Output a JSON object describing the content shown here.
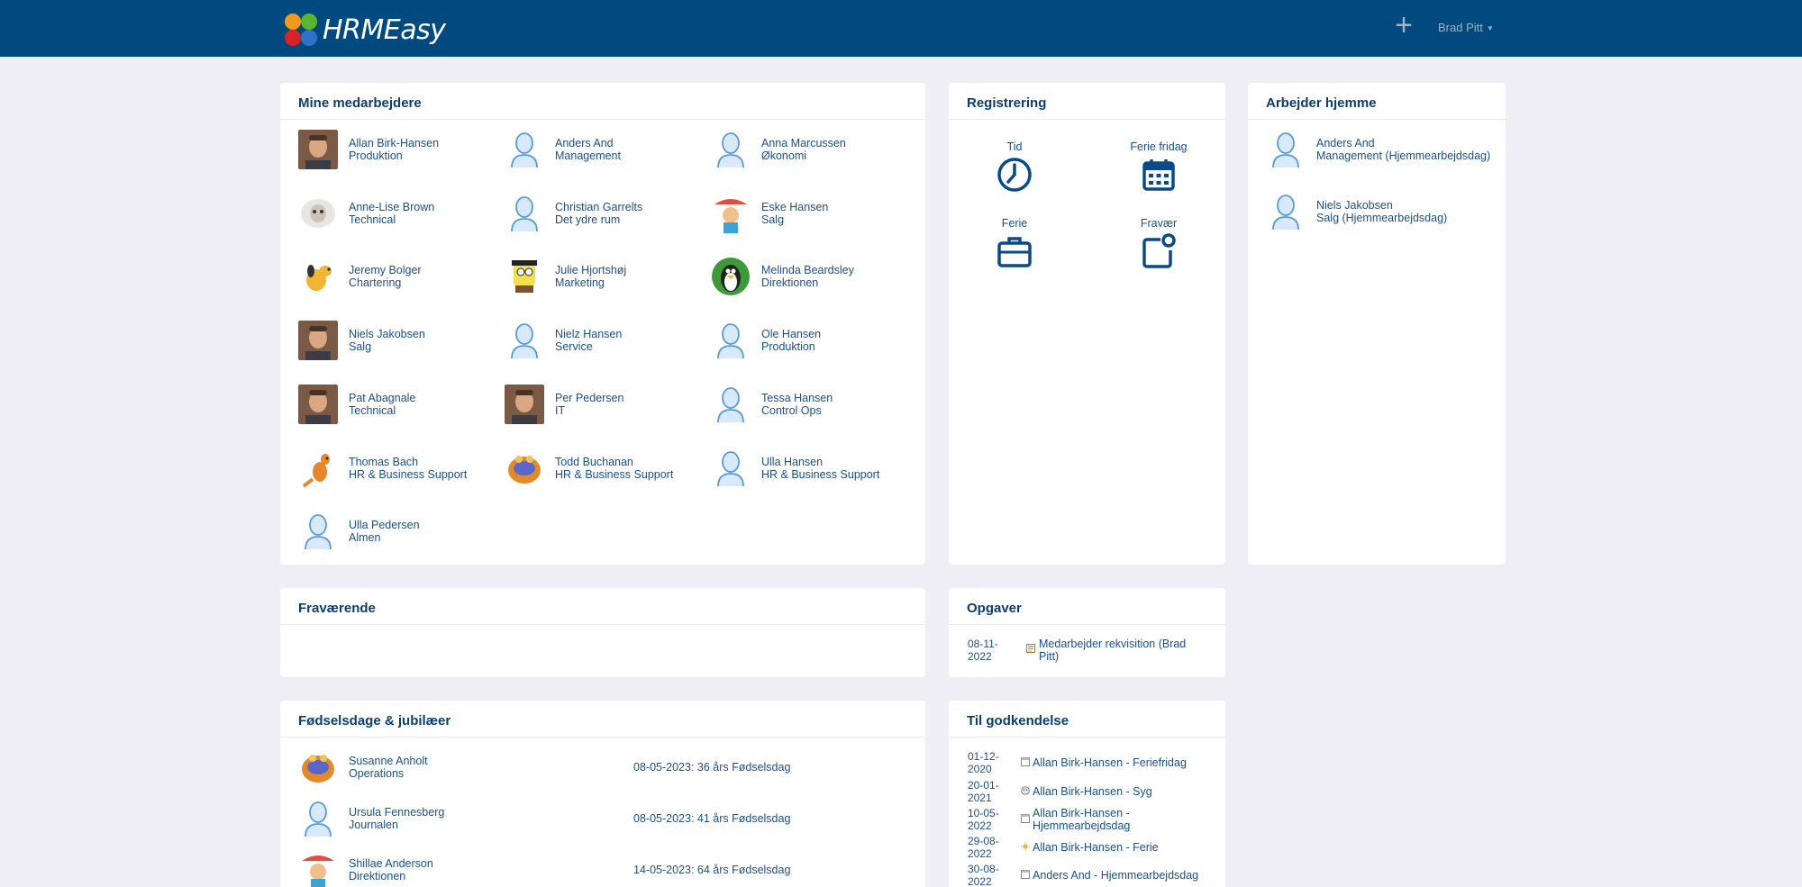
{
  "app": {
    "name": "HRMEasy"
  },
  "header": {
    "user_name": "Brad Pitt",
    "add_icon": "plus-icon"
  },
  "colors": {
    "topbar": "#004a80",
    "background": "#eeeef4",
    "text": "#1b4f88",
    "icon": "#0b4a86"
  },
  "employees_panel": {
    "title": "Mine medarbejdere",
    "items": [
      {
        "name": "Allan Birk-Hansen",
        "dept": "Produktion",
        "avatar": "photo"
      },
      {
        "name": "Anders And",
        "dept": "Management",
        "avatar": "default"
      },
      {
        "name": "Anna Marcussen",
        "dept": "Økonomi",
        "avatar": "default"
      },
      {
        "name": "Anne-Lise Brown",
        "dept": "Technical",
        "avatar": "sheep"
      },
      {
        "name": "Christian Garrelts",
        "dept": "Det ydre rum",
        "avatar": "default"
      },
      {
        "name": "Eske Hansen",
        "dept": "Salg",
        "avatar": "cartoon"
      },
      {
        "name": "Jeremy Bolger",
        "dept": "Chartering",
        "avatar": "dog"
      },
      {
        "name": "Julie Hjortshøj",
        "dept": "Marketing",
        "avatar": "sponge"
      },
      {
        "name": "Melinda Beardsley",
        "dept": "Direktionen",
        "avatar": "penguin"
      },
      {
        "name": "Niels Jakobsen",
        "dept": "Salg",
        "avatar": "photo"
      },
      {
        "name": "Nielz Hansen",
        "dept": "Service",
        "avatar": "default"
      },
      {
        "name": "Ole Hansen",
        "dept": "Produktion",
        "avatar": "default"
      },
      {
        "name": "Pat Abagnale",
        "dept": "Technical",
        "avatar": "photo"
      },
      {
        "name": "Per Pedersen",
        "dept": "IT",
        "avatar": "photo"
      },
      {
        "name": "Tessa Hansen",
        "dept": "Control Ops",
        "avatar": "default"
      },
      {
        "name": "Thomas Bach",
        "dept": "HR & Business Support",
        "avatar": "kangaroo"
      },
      {
        "name": "Todd Buchanan",
        "dept": "HR & Business Support",
        "avatar": "monster"
      },
      {
        "name": "Ulla Hansen",
        "dept": "HR & Business Support",
        "avatar": "default"
      },
      {
        "name": "Ulla Pedersen",
        "dept": "Almen",
        "avatar": "default"
      }
    ]
  },
  "registration_panel": {
    "title": "Registrering",
    "items": [
      {
        "label": "Tid",
        "icon": "clock-icon"
      },
      {
        "label": "Ferie fridag",
        "icon": "calendar-icon"
      },
      {
        "label": "Ferie",
        "icon": "briefcase-icon"
      },
      {
        "label": "Fravær",
        "icon": "notification-icon"
      }
    ]
  },
  "home_panel": {
    "title": "Arbejder hjemme",
    "items": [
      {
        "name": "Anders And",
        "dept": "Management (Hjemmearbejdsdag)"
      },
      {
        "name": "Niels Jakobsen",
        "dept": "Salg (Hjemmearbejdsdag)"
      }
    ]
  },
  "absent_panel": {
    "title": "Fraværende"
  },
  "tasks_panel": {
    "title": "Opgaver",
    "items": [
      {
        "date_line1": "08-11-",
        "date_line2": "2022",
        "text_line1": "Medarbejder rekvisition (Brad",
        "text_line2": "Pitt)",
        "icon": "form-icon"
      }
    ]
  },
  "birthdays_panel": {
    "title": "Fødselsdage & jubilæer",
    "items": [
      {
        "name": "Susanne Anholt",
        "dept": "Operations",
        "event": "08-05-2023: 36 års Fødselsdag",
        "avatar": "monster"
      },
      {
        "name": "Ursula Fennesberg",
        "dept": "Journalen",
        "event": "08-05-2023: 41 års Fødselsdag",
        "avatar": "default"
      },
      {
        "name": "Shillae Anderson",
        "dept": "Direktionen",
        "event": "14-05-2023: 64 års Fødselsdag",
        "avatar": "cartoon"
      }
    ]
  },
  "approval_panel": {
    "title": "Til godkendelse",
    "items": [
      {
        "date_line1": "01-12-",
        "date_line2": "2020",
        "text_line1": "Allan Birk-Hansen - Feriefridag",
        "text_line2": "",
        "icon": "calendar-small-icon"
      },
      {
        "date_line1": "20-01-",
        "date_line2": "2021",
        "text_line1": "Allan Birk-Hansen - Syg",
        "text_line2": "",
        "icon": "sick-icon"
      },
      {
        "date_line1": "10-05-",
        "date_line2": "2022",
        "text_line1": "Allan Birk-Hansen -",
        "text_line2": "Hjemmearbejdsdag",
        "icon": "calendar-small-icon"
      },
      {
        "date_line1": "29-08-",
        "date_line2": "2022",
        "text_line1": "Allan Birk-Hansen - Ferie",
        "text_line2": "",
        "icon": "sun-icon"
      },
      {
        "date_line1": "30-08-",
        "date_line2": "2022",
        "text_line1": "Anders And - Hjemmearbejdsdag",
        "text_line2": "",
        "icon": "calendar-small-icon"
      }
    ]
  }
}
